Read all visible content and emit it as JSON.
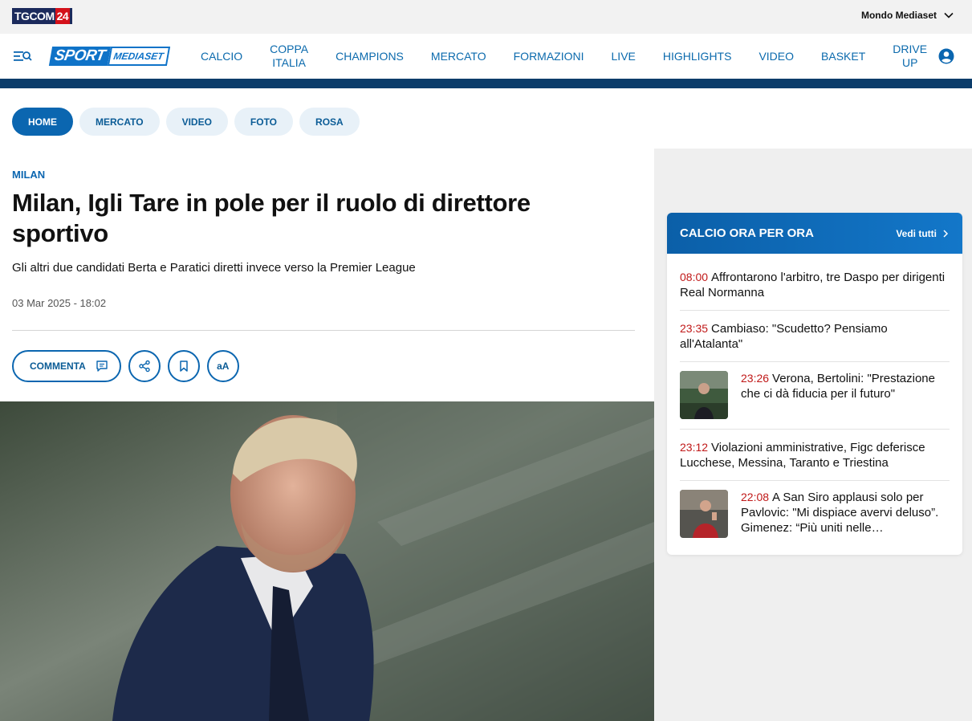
{
  "topbar": {
    "logo_text": "TGCOM",
    "logo_number": "24",
    "mondo_label": "Mondo Mediaset"
  },
  "nav": {
    "logo_sport": "SPORT",
    "logo_mediaset": "MEDIASET",
    "items": [
      "CALCIO",
      "COPPA\nITALIA",
      "CHAMPIONS",
      "MERCATO",
      "FORMAZIONI",
      "LIVE",
      "HIGHLIGHTS",
      "VIDEO",
      "BASKET",
      "DRIVE\nUP"
    ]
  },
  "tabs": [
    {
      "label": "HOME",
      "active": true
    },
    {
      "label": "MERCATO",
      "active": false
    },
    {
      "label": "VIDEO",
      "active": false
    },
    {
      "label": "FOTO",
      "active": false
    },
    {
      "label": "ROSA",
      "active": false
    }
  ],
  "article": {
    "kicker": "MILAN",
    "title": "Milan, Igli Tare in pole per il ruolo di direttore sportivo",
    "subtitle": "Gli altri due candidati Berta e Paratici diretti invece verso la Premier League",
    "date": "03 Mar 2025 - 18:02",
    "comment_label": "COMMENTA",
    "font_button_label": "aA"
  },
  "widget": {
    "title": "CALCIO ORA PER ORA",
    "see_all": "Vedi tutti",
    "items": [
      {
        "time": "08:00",
        "text": "Affrontarono l'arbitro, tre Daspo per dirigenti Real Normanna",
        "thumb": false
      },
      {
        "time": "23:35",
        "text": "Cambiaso: \"Scudetto? Pensiamo all'Atalanta\"",
        "thumb": false
      },
      {
        "time": "23:26",
        "text": "Verona, Bertolini: \"Prestazione che ci dà fiducia per il futuro\"",
        "thumb": true
      },
      {
        "time": "23:12",
        "text": "Violazioni amministrative, Figc deferisce Lucchese, Messina, Taranto e Triestina",
        "thumb": false
      },
      {
        "time": "22:08",
        "text": "A San Siro applausi solo per Pavlovic: \"Mi dispiace avervi deluso”. Gimenez: “Più uniti nelle…",
        "thumb": true
      }
    ]
  },
  "colors": {
    "brand_blue": "#0b66b0",
    "nav_bar": "#0b3c6a",
    "time_red": "#c01818",
    "tg_red": "#d4111a"
  }
}
